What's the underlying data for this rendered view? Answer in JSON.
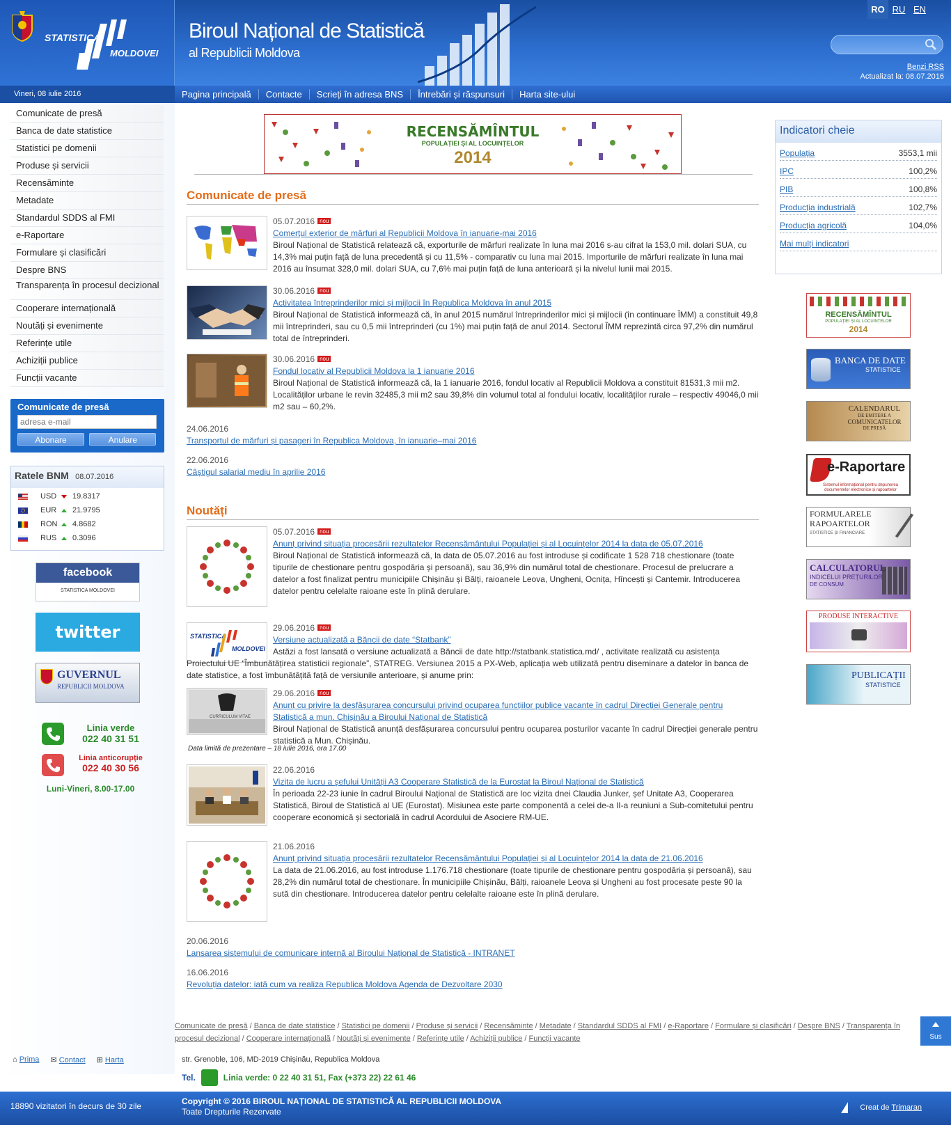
{
  "header": {
    "logo_line1": "STATISTICA",
    "logo_line2": "MOLDOVEI",
    "title": "Biroul Național de Statistică",
    "subtitle": "al Republicii Moldova",
    "langs": [
      "RO",
      "RU",
      "EN"
    ],
    "rss": "Benzi RSS",
    "updated": "Actualizat la: 08.07.2016",
    "date": "Vineri, 08 iulie 2016"
  },
  "nav": [
    "Pagina principală",
    "Contacte",
    "Scrieți în adresa BNS",
    "Întrebări și răspunsuri",
    "Harta site-ului"
  ],
  "sidebar": {
    "menu": [
      "Comunicate de presă",
      "Banca de date statistice",
      "Statistici pe domenii",
      "Produse și servicii",
      "Recensăminte",
      "Metadate",
      "Standardul SDDS al FMI",
      "e-Raportare",
      "Formulare și clasificări",
      "Despre BNS",
      "Transparența în procesul decizional",
      "Cooperare internațională",
      "Noutăți și evenimente",
      "Referințe utile",
      "Achiziții publice",
      "Funcții vacante"
    ],
    "press": {
      "title": "Comunicate de presă",
      "placeholder": "adresa e-mail",
      "subscribe": "Abonare",
      "unsubscribe": "Anulare"
    },
    "bnm": {
      "title": "Ratele BNM",
      "date": "08.07.2016",
      "rates": [
        {
          "cur": "USD",
          "value": "19.8317",
          "trend": "down"
        },
        {
          "cur": "EUR",
          "value": "21.9795",
          "trend": "up"
        },
        {
          "cur": "RON",
          "value": "4.8682",
          "trend": "up"
        },
        {
          "cur": "RUS",
          "value": "0.3096",
          "trend": "up"
        }
      ]
    },
    "banners": {
      "facebook": "facebook",
      "twitter": "twitter",
      "gov1": "GUVERNUL",
      "gov2": "REPUBLICII MOLDOVA"
    },
    "green_line": {
      "label": "Linia verde",
      "number": "022 40 31 51"
    },
    "anticorruption": {
      "label": "Linia anticorupție",
      "number": "022 40 30 56"
    },
    "hours": "Luni-Vineri, 8.00-17.00",
    "footer_links": [
      "Prima",
      "Contact",
      "Harta"
    ],
    "visitors": "18890 vizitatori în decurs de 30 zile"
  },
  "census_banner": {
    "line1": "RECENSĂMÎNTUL",
    "line2": "POPULAȚIEI ȘI AL LOCUINȚELOR",
    "year": "2014"
  },
  "press_section": {
    "title": "Comunicate de presă",
    "items": [
      {
        "date": "05.07.2016",
        "new": "nou",
        "title": "Comerțul exterior de mărfuri al Republicii Moldova în ianuarie-mai 2016",
        "text": "Biroul Național de Statistică relatează că, exporturile de mărfuri realizate în luna mai 2016 s-au cifrat la 153,0 mil. dolari SUA, cu 14,3% mai puțin față de luna precedentă și cu 11,5% - comparativ cu luna mai 2015. Importurile de mărfuri realizate în luna mai 2016 au însumat 328,0 mil. dolari SUA, cu 7,6% mai puțin față de luna anterioară și la nivelul lunii mai 2015."
      },
      {
        "date": "30.06.2016",
        "new": "nou",
        "title": "Activitatea întreprinderilor mici și mijlocii în Republica Moldova în anul 2015",
        "text": "Biroul Național de Statistică informează că, în anul 2015 numărul întreprinderilor mici și mijlocii (în continuare ÎMM) a constituit 49,8 mii întreprinderi, sau cu 0,5 mii întreprinderi (cu 1%) mai puțin față de anul 2014. Sectorul ÎMM reprezintă circa 97,2% din numărul total de întreprinderi."
      },
      {
        "date": "30.06.2016",
        "new": "nou",
        "title": "Fondul locativ al Republicii Moldova la 1 ianuarie 2016",
        "text": "Biroul Național de Statistică informează că, la 1 ianuarie 2016, fondul locativ al Republicii Moldova a constituit 81531,3 mii m2. Localităților urbane le revin 32485,3 mii m2 sau 39,8% din volumul total al fondului locativ, localităților rurale – respectiv 49046,0 mii m2 sau – 60,2%."
      },
      {
        "date": "24.06.2016",
        "title": "Transportul de mărfuri și pasageri în Republica Moldova, în ianuarie–mai 2016"
      },
      {
        "date": "22.06.2016",
        "title": "Câștigul salarial mediu în aprilie 2016"
      }
    ]
  },
  "news_section": {
    "title": "Noutăți",
    "items": [
      {
        "date": "05.07.2016",
        "new": "nou",
        "title": "Anunț privind situația procesării rezultatelor Recensământului Populației și al Locuințelor 2014 la data de 05.07.2016",
        "text": "Biroul Național de Statistică informează că, la data de 05.07.2016 au fost introduse și codificate 1 528 718 chestionare (toate tipurile de chestionare pentru gospodăria și persoană), sau 36,9% din numărul total de chestionare. Procesul de prelucrare a datelor a fost finalizat pentru municipiile Chișinău și Bălți, raioanele Leova, Ungheni, Ocnița, Hîncești și Cantemir. Introducerea datelor pentru celelalte raioane este în plină derulare."
      },
      {
        "date": "29.06.2016",
        "new": "nou",
        "title": "Versiune actualizată a Băncii de date “Statbank”",
        "text": "Astăzi a fost lansată o versiune actualizată a Băncii de date http://statbank.statistica.md/ , activitate realizată cu asistența Proiectului UE “Îmbunătățirea statisticii regionale”, STATREG. Versiunea 2015 a PX-Web, aplicația web utilizată pentru diseminare a datelor în banca de date statistice, a fost îmbunătățită față de versiunile anterioare, și anume prin:"
      },
      {
        "date": "29.06.2016",
        "new": "nou",
        "title": "Anunț cu privire la desfășurarea concursului privind ocuparea funcțiilor publice vacante în cadrul Direcției Generale pentru Statistică a mun. Chișinău a Biroului Național de Statistică",
        "text": "Biroul Național de Statistică anunță desfășurarea concursului pentru ocuparea posturilor vacante în cadrul Direcției generale pentru statistică a Mun. Chișinău.",
        "note": "Data limită de prezentare – 18 iulie 2016, ora 17.00"
      },
      {
        "date": "22.06.2016",
        "title": "Vizita de lucru a șefului Unității A3 Cooperare Statistică de la Eurostat la Biroul Național de Statistică",
        "text": "În perioada 22-23 iunie în cadrul Biroului Național de Statistică are loc vizita dnei Claudia Junker, șef Unitate A3, Cooperarea Statistică, Biroul de Statistică al UE (Eurostat). Misiunea este parte componentă a celei de-a II-a reuniuni a Sub-comitetului pentru cooperare economică și sectorială în cadrul Acordului de Asociere RM-UE."
      },
      {
        "date": "21.06.2016",
        "title": "Anunț privind situația procesării rezultatelor Recensământului Populației și al Locuințelor 2014 la data de 21.06.2016",
        "text": "La data de 21.06.2016, au fost introduse 1.176.718 chestionare (toate tipurile de chestionare pentru gospodăria și persoană), sau 28,2% din numărul total de chestionare. În municipiile Chișinău, Bălți, raioanele Leova și Ungheni au fost procesate peste 90 la sută din chestionare. Introducerea datelor pentru celelalte raioane este în plină derulare."
      },
      {
        "date": "20.06.2016",
        "title": "Lansarea sistemului de comunicare internă al Biroului Național de Statistică - INTRANET"
      },
      {
        "date": "16.06.2016",
        "title": "Revoluția datelor: iată cum va realiza Republica Moldova Agenda de Dezvoltare 2030"
      }
    ]
  },
  "indicators": {
    "title": "Indicatori cheie",
    "rows": [
      {
        "name": "Populația",
        "value": "3553,1 mii"
      },
      {
        "name": "IPC",
        "value": "100,2%"
      },
      {
        "name": "PIB",
        "value": "100,8%"
      },
      {
        "name": "Producția industrială",
        "value": "102,7%"
      },
      {
        "name": "Producția agricolă",
        "value": "104,0%"
      }
    ],
    "more": "Mai mulți indicatori"
  },
  "right_banners": {
    "census": {
      "l1": "RECENSĂMÎNTUL",
      "l2": "POPULAȚIEI ȘI AL LOCUINȚELOR",
      "l3": "2014"
    },
    "bank": {
      "l1": "BANCA DE DATE",
      "l2": "STATISTICE"
    },
    "calendar": {
      "l1": "CALENDARUL",
      "l2": "DE EMITERE A",
      "l3": "COMUNICATELOR",
      "l4": "DE PRESĂ"
    },
    "eraport": {
      "l1": "e-Raportare",
      "l2": "Sistemul informațional pentru depunerea documentelor electronice și rapoartelor"
    },
    "forms": {
      "l1": "FORMULARELE",
      "l2": "RAPOARTELOR",
      "l3": "STATISTICE ȘI FINANCIARE"
    },
    "calc": {
      "l1": "CALCULATORUL",
      "l2": "INDICELUI PREȚURILOR",
      "l3": "DE CONSUM"
    },
    "interactive": {
      "l1": "PRODUSE INTERACTIVE"
    },
    "pubs": {
      "l1": "PUBLICAȚII",
      "l2": "STATISTICE"
    }
  },
  "footer": {
    "links": [
      "Comunicate de presă",
      "Banca de date statistice",
      "Statistici pe domenii",
      "Produse și servicii",
      "Recensăminte",
      "Metadate",
      "Standardul SDDS al FMI",
      "e-Raportare",
      "Formulare și clasificări",
      "Despre BNS",
      "Transparența în procesul decizional",
      "Cooperare internațională",
      "Noutăți și evenimente",
      "Referințe utile",
      "Achiziții publice",
      "Funcții vacante"
    ],
    "top": "Sus",
    "address": "str. Grenoble, 106, MD-2019 Chișinău, Republica Moldova",
    "tel_label": "Tel.",
    "tel": "Linia verde: 0 22 40 31 51, Fax (+373 22) 22 61 46",
    "copyright": "Copyright © 2016 BIROUL NAȚIONAL DE STATISTICĂ AL REPUBLICII MOLDOVA",
    "rights": "Toate Drepturile Rezervate",
    "creat_prefix": "Creat de",
    "creat_by": "Trimaran"
  }
}
